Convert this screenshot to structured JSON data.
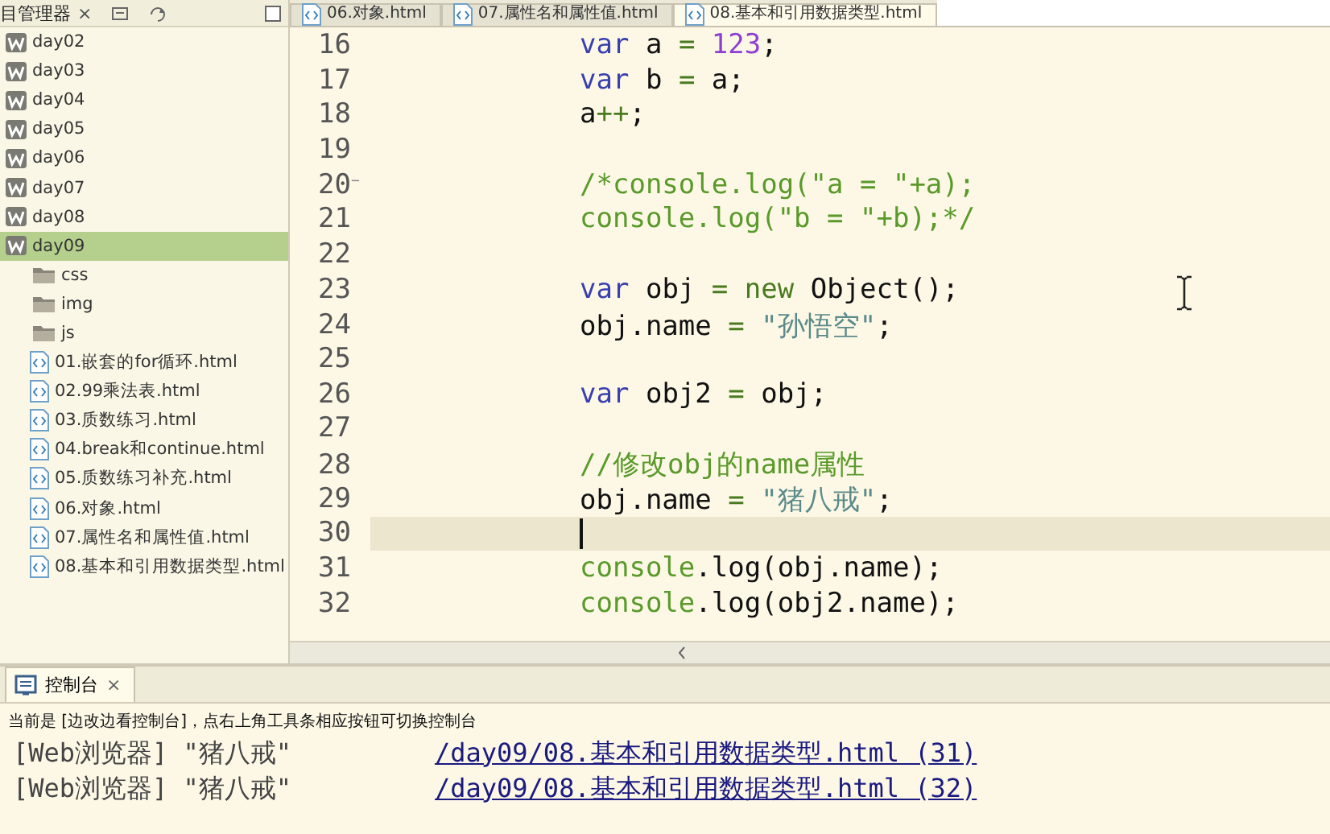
{
  "explorer": {
    "title": "目管理器",
    "close": "×",
    "tree": [
      {
        "kind": "project",
        "label": "day02",
        "selected": false
      },
      {
        "kind": "project",
        "label": "day03",
        "selected": false
      },
      {
        "kind": "project",
        "label": "day04",
        "selected": false
      },
      {
        "kind": "project",
        "label": "day05",
        "selected": false
      },
      {
        "kind": "project",
        "label": "day06",
        "selected": false
      },
      {
        "kind": "project",
        "label": "day07",
        "selected": false
      },
      {
        "kind": "project",
        "label": "day08",
        "selected": false
      },
      {
        "kind": "project",
        "label": "day09",
        "selected": true,
        "children": [
          {
            "kind": "folder",
            "label": "css",
            "selected": false
          },
          {
            "kind": "folder",
            "label": "img",
            "selected": false
          },
          {
            "kind": "folder",
            "label": "js",
            "selected": false
          },
          {
            "kind": "file",
            "label": "01.嵌套的for循环.html",
            "selected": false
          },
          {
            "kind": "file",
            "label": "02.99乘法表.html",
            "selected": false
          },
          {
            "kind": "file",
            "label": "03.质数练习.html",
            "selected": false
          },
          {
            "kind": "file",
            "label": "04.break和continue.html",
            "selected": false
          },
          {
            "kind": "file",
            "label": "05.质数练习补充.html",
            "selected": false
          },
          {
            "kind": "file",
            "label": "06.对象.html",
            "selected": false
          },
          {
            "kind": "file",
            "label": "07.属性名和属性值.html",
            "selected": false
          },
          {
            "kind": "file",
            "label": "08.基本和引用数据类型.html",
            "selected": false
          }
        ]
      }
    ]
  },
  "editor": {
    "tabs": [
      {
        "label": "06.对象.html",
        "selected": false
      },
      {
        "label": "07.属性名和属性值.html",
        "selected": false
      },
      {
        "label": "08.基本和引用数据类型.html",
        "selected": true
      }
    ],
    "lines": [
      {
        "number": "16",
        "current": false,
        "tokens": [
          {
            "kind": "keyword",
            "text": "var "
          },
          {
            "kind": "plain",
            "text": "a "
          },
          {
            "kind": "operator",
            "text": "= "
          },
          {
            "kind": "number",
            "text": "123"
          },
          {
            "kind": "plain",
            "text": ";"
          }
        ]
      },
      {
        "number": "17",
        "current": false,
        "tokens": [
          {
            "kind": "keyword",
            "text": "var "
          },
          {
            "kind": "plain",
            "text": "b "
          },
          {
            "kind": "operator",
            "text": "= "
          },
          {
            "kind": "plain",
            "text": "a;"
          }
        ]
      },
      {
        "number": "18",
        "current": false,
        "tokens": [
          {
            "kind": "plain",
            "text": "a"
          },
          {
            "kind": "operator",
            "text": "++"
          },
          {
            "kind": "plain",
            "text": ";"
          }
        ]
      },
      {
        "number": "19",
        "current": false
      },
      {
        "number": "20",
        "current": false,
        "fold": "−",
        "tokens": [
          {
            "kind": "comment",
            "text": "/*console.log(\"a = \"+a);"
          }
        ]
      },
      {
        "number": "21",
        "current": false,
        "tokens": [
          {
            "kind": "comment",
            "text": "console.log(\"b = \"+b);*/"
          }
        ]
      },
      {
        "number": "22",
        "current": false
      },
      {
        "number": "23",
        "current": false,
        "tokens": [
          {
            "kind": "keyword",
            "text": "var "
          },
          {
            "kind": "plain",
            "text": "obj "
          },
          {
            "kind": "operator",
            "text": "= new "
          },
          {
            "kind": "plain",
            "text": "Object();"
          }
        ]
      },
      {
        "number": "24",
        "current": false,
        "tokens": [
          {
            "kind": "plain",
            "text": "obj.name "
          },
          {
            "kind": "operator",
            "text": "= "
          },
          {
            "kind": "string",
            "text": "\"孙悟空\""
          },
          {
            "kind": "plain",
            "text": ";"
          }
        ]
      },
      {
        "number": "25",
        "current": false
      },
      {
        "number": "26",
        "current": false,
        "tokens": [
          {
            "kind": "keyword",
            "text": "var "
          },
          {
            "kind": "plain",
            "text": "obj2 "
          },
          {
            "kind": "operator",
            "text": "= "
          },
          {
            "kind": "plain",
            "text": "obj;"
          }
        ]
      },
      {
        "number": "27",
        "current": false
      },
      {
        "number": "28",
        "current": false,
        "tokens": [
          {
            "kind": "comment",
            "text": "//修改obj的name属性"
          }
        ]
      },
      {
        "number": "29",
        "current": false,
        "tokens": [
          {
            "kind": "plain",
            "text": "obj.name "
          },
          {
            "kind": "operator",
            "text": "= "
          },
          {
            "kind": "string",
            "text": "\"猪八戒\""
          },
          {
            "kind": "plain",
            "text": ";"
          }
        ]
      },
      {
        "number": "30",
        "current": true
      },
      {
        "number": "31",
        "current": false,
        "tokens": [
          {
            "kind": "comment",
            "text": "console"
          },
          {
            "kind": "plain",
            "text": ".log(obj.name);"
          }
        ]
      },
      {
        "number": "32",
        "current": false,
        "tokens": [
          {
            "kind": "comment",
            "text": "console"
          },
          {
            "kind": "plain",
            "text": ".log(obj2.name);"
          }
        ]
      }
    ]
  },
  "console": {
    "tab": {
      "label": "控制台",
      "close": "×",
      "selected": true
    },
    "notice": "当前是 [边改边看控制台]，点右上角工具条相应按钮可切换控制台",
    "output": [
      {
        "message": "[Web浏览器] \"猪八戒\"",
        "source": "/day09/08.基本和引用数据类型.html (31)"
      },
      {
        "message": "[Web浏览器] \"猪八戒\"",
        "source": "/day09/08.基本和引用数据类型.html (32)"
      }
    ]
  }
}
